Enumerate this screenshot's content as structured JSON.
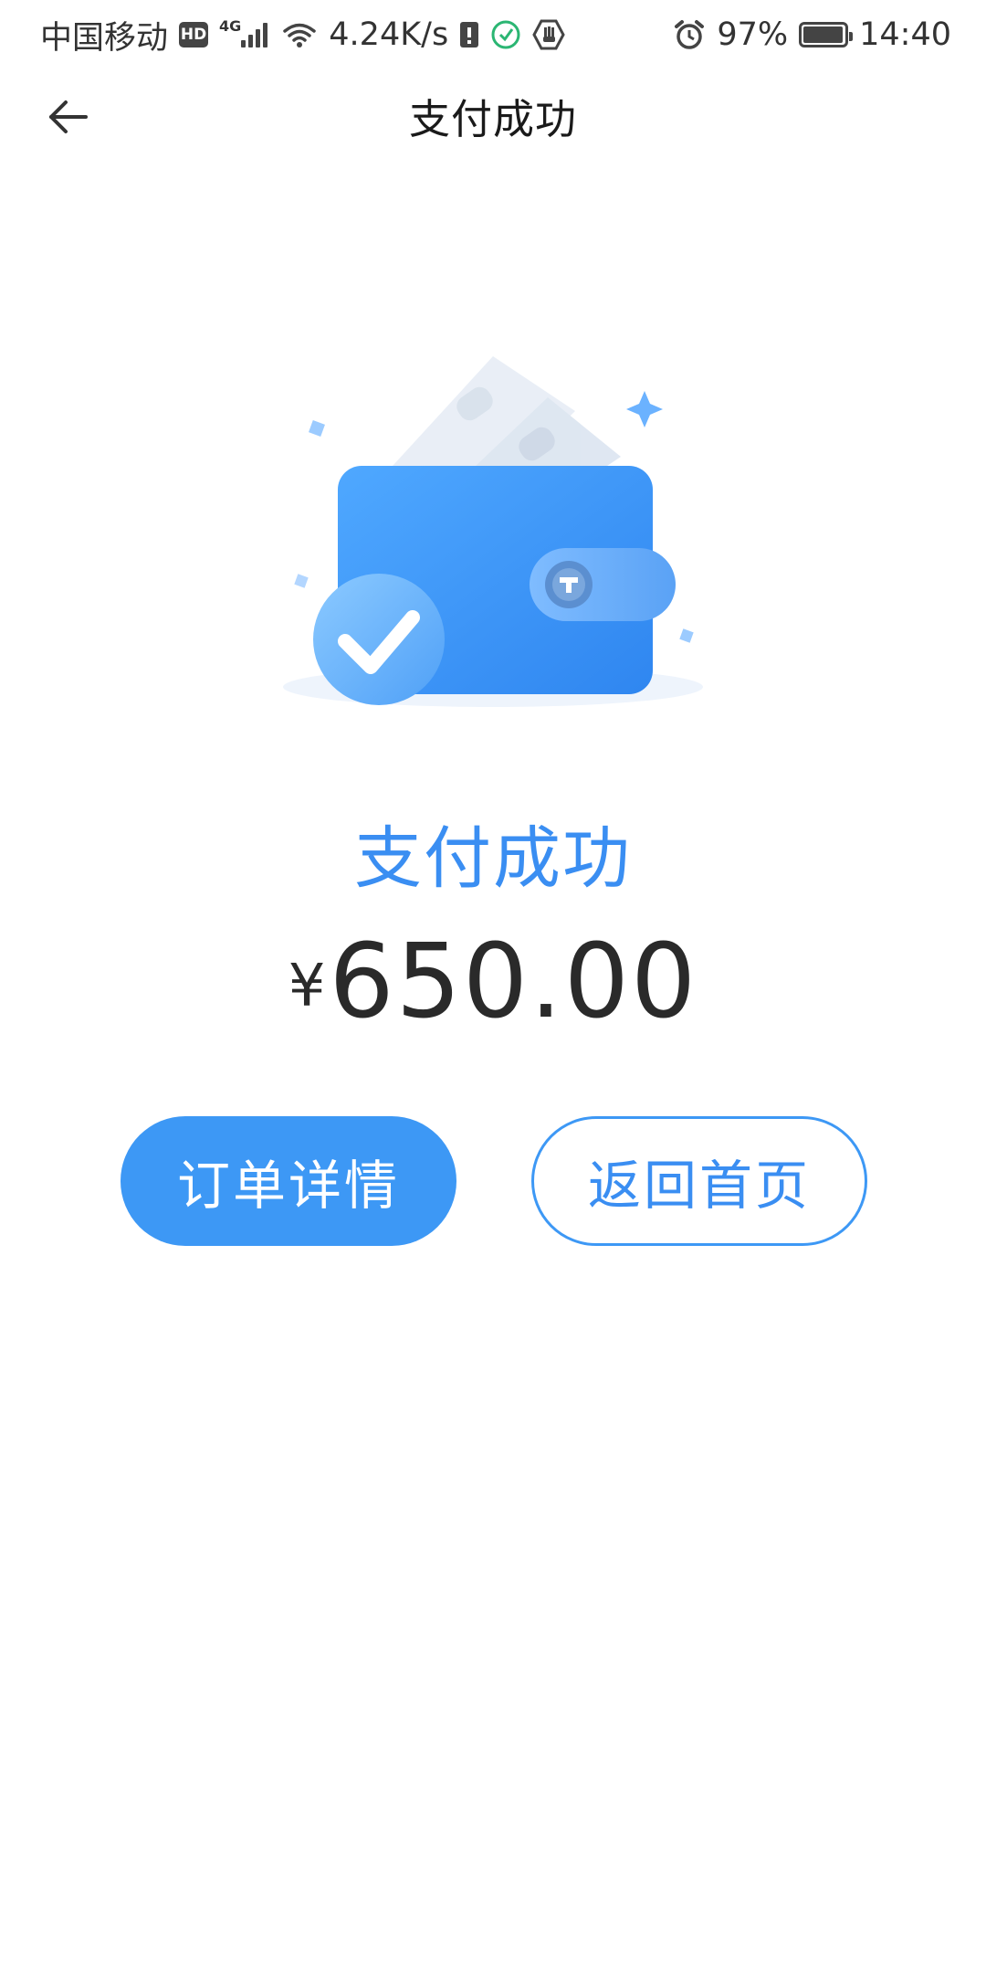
{
  "status_bar": {
    "carrier": "中国移动",
    "hd": "HD",
    "network_type": "4G",
    "speed": "4.24K/s",
    "battery_percent": "97%",
    "battery_level": 0.97,
    "time": "14:40",
    "icons": [
      "hd-icon",
      "signal-icon",
      "wifi-icon",
      "sim-alert-icon",
      "app-notification-icon",
      "hand-icon",
      "alarm-icon",
      "battery-icon"
    ]
  },
  "nav": {
    "title": "支付成功",
    "back_icon": "arrow-left-icon"
  },
  "result": {
    "title": "支付成功",
    "currency_symbol": "¥",
    "amount": "650.00"
  },
  "actions": {
    "order_details_label": "订单详情",
    "back_home_label": "返回首页"
  },
  "colors": {
    "accent": "#3d98f5",
    "accent_text": "#3a8ef2",
    "amount_text": "#2a2a2a"
  }
}
